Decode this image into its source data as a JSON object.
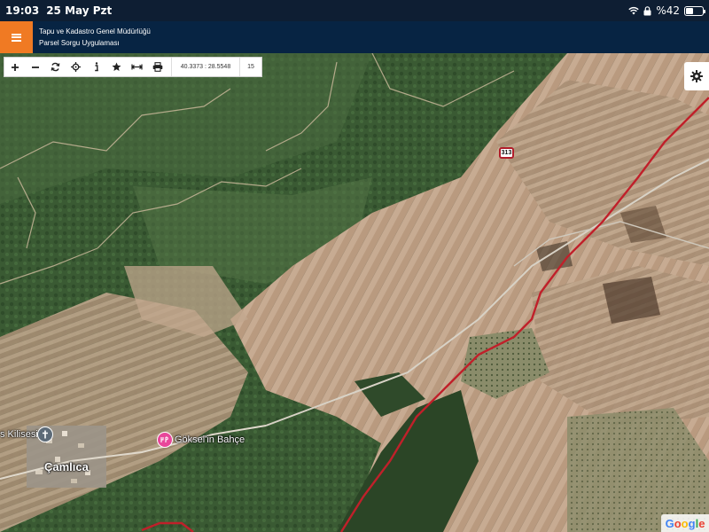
{
  "status_bar": {
    "time": "19:03",
    "date": "25 May Pzt",
    "battery_text": "%42",
    "battery_level": 0.42
  },
  "app_header": {
    "title_line1": "Tapu ve Kadastro Genel Müdürlüğü",
    "title_line2": "Parsel Sorgu Uygulaması",
    "menu_icon": "hamburger-icon",
    "accent_color": "#f07a23",
    "header_color": "#072443"
  },
  "toolbar": {
    "tools": [
      {
        "name": "zoom-in-icon",
        "glyph": "+"
      },
      {
        "name": "zoom-out-icon",
        "glyph": "−"
      },
      {
        "name": "refresh-icon",
        "glyph": "↻"
      },
      {
        "name": "locate-icon",
        "glyph": "⌖"
      },
      {
        "name": "info-icon",
        "glyph": "i"
      },
      {
        "name": "favorite-star-icon",
        "glyph": "★"
      },
      {
        "name": "measure-icon",
        "glyph": "↔"
      },
      {
        "name": "print-icon",
        "glyph": "⎙"
      }
    ],
    "coordinates": "40.3373 : 28.5548",
    "zoom_level": "15"
  },
  "map": {
    "road_shield": "313",
    "places": [
      {
        "name": "s Kilisesi",
        "icon": "church-cross-icon"
      },
      {
        "name": "Çamlıca"
      },
      {
        "name": "Göksel'in Bahçe",
        "icon": "restaurant-pin-icon",
        "icon_color": "#e8479a"
      }
    ],
    "boundary_color": "#c0202a",
    "attribution": "Google"
  },
  "settings_icon": "gear-icon"
}
